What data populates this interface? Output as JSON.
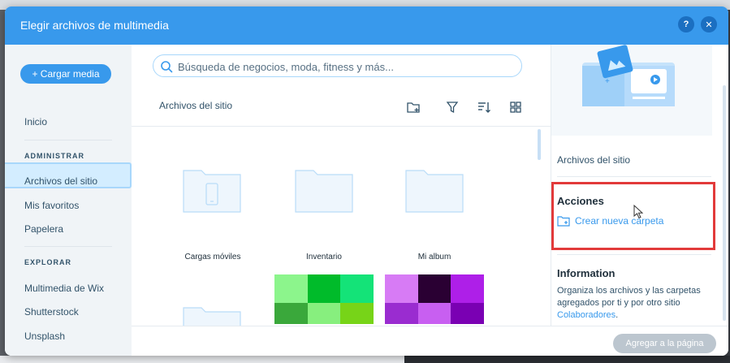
{
  "modal": {
    "title": "Elegir archivos de multimedia",
    "help_label": "?",
    "close_label": "✕"
  },
  "sidebar": {
    "upload_label": "+ Cargar media",
    "home": "Inicio",
    "section_manage": "ADMINISTRAR",
    "manage_items": [
      "Archivos del sitio",
      "Mis favoritos",
      "Papelera"
    ],
    "section_explore": "EXPLORAR",
    "explore_items": [
      "Multimedia de Wix",
      "Shutterstock",
      "Unsplash"
    ],
    "active_item": "Archivos del sitio"
  },
  "search": {
    "placeholder": "Búsqueda de negocios, moda, fitness y más..."
  },
  "main": {
    "breadcrumb": "Archivos del sitio",
    "toolbar_icons": [
      "new-folder-icon",
      "filter-icon",
      "sort-icon",
      "grid-view-icon"
    ],
    "folders": [
      {
        "name": "Cargas móviles",
        "icon": "phone-icon"
      },
      {
        "name": "Inventario"
      },
      {
        "name": "Mi album"
      },
      {
        "name": ""
      }
    ],
    "images": [
      {
        "name": "green-squares",
        "colors": [
          "#8cf58c",
          "#00bb2a",
          "#14e378",
          "#3aa83b",
          "#87ef7e",
          "#77d418"
        ]
      },
      {
        "name": "purple-squares",
        "colors": [
          "#d77bf5",
          "#2a0033",
          "#ae1fe8",
          "#9a2cd0",
          "#c85ff1",
          "#7a00b3"
        ]
      }
    ]
  },
  "right_panel": {
    "folder_name": "Archivos del sitio",
    "actions_heading": "Acciones",
    "create_folder_label": "Crear nueva carpeta",
    "info_heading": "Information",
    "info_text": "Organiza los archivos y las carpetas agregados por ti y por otro sitio",
    "info_link": "Colaboradores",
    "info_end": "."
  },
  "footer": {
    "add_to_page_label": "Agregar a la página"
  },
  "colors": {
    "header": "#3899ec",
    "accent": "#3899ec",
    "highlight": "#e23a3a"
  }
}
